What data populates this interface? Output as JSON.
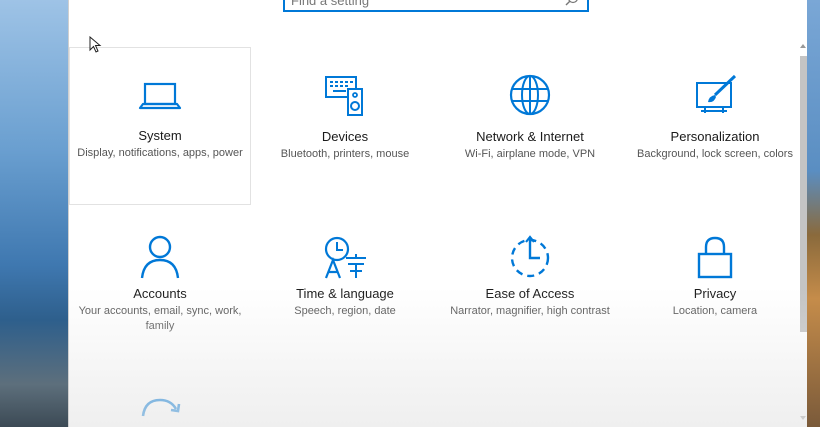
{
  "search": {
    "placeholder": "Find a setting"
  },
  "tiles": [
    {
      "name": "System",
      "desc": "Display, notifications, apps, power",
      "icon": "laptop-icon"
    },
    {
      "name": "Devices",
      "desc": "Bluetooth, printers, mouse",
      "icon": "devices-icon"
    },
    {
      "name": "Network & Internet",
      "desc": "Wi-Fi, airplane mode, VPN",
      "icon": "globe-icon"
    },
    {
      "name": "Personalization",
      "desc": "Background, lock screen, colors",
      "icon": "paint-icon"
    },
    {
      "name": "Accounts",
      "desc": "Your accounts, email, sync, work, family",
      "icon": "person-icon"
    },
    {
      "name": "Time & language",
      "desc": "Speech, region, date",
      "icon": "time-language-icon"
    },
    {
      "name": "Ease of Access",
      "desc": "Narrator, magnifier, high contrast",
      "icon": "ease-of-access-icon"
    },
    {
      "name": "Privacy",
      "desc": "Location, camera",
      "icon": "lock-icon"
    }
  ],
  "partial_icon": "update-icon",
  "colors": {
    "accent": "#0078d7"
  }
}
